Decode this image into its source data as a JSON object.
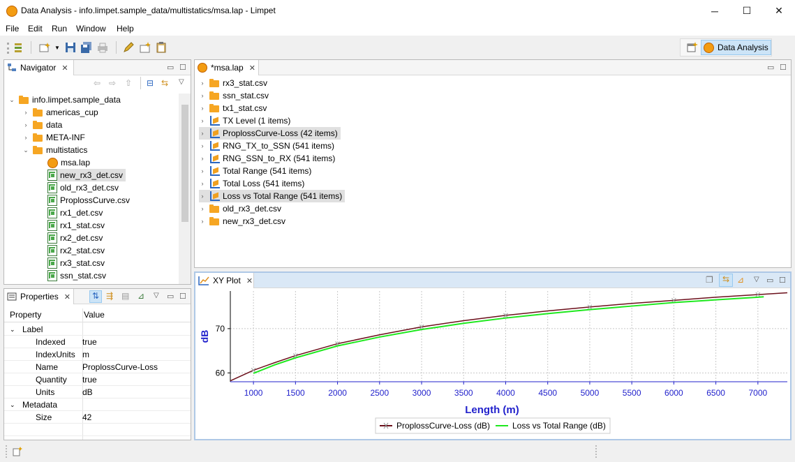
{
  "window": {
    "title": "Data Analysis - info.limpet.sample_data/multistatics/msa.lap - Limpet",
    "minimize": "─",
    "maximize": "☐",
    "close": "✕"
  },
  "menu": [
    "File",
    "Edit",
    "Run",
    "Window",
    "Help"
  ],
  "perspective": {
    "label": "Data Analysis"
  },
  "navigator": {
    "title": "Navigator",
    "root": "info.limpet.sample_data",
    "folders": [
      "americas_cup",
      "data",
      "META-INF",
      "multistatics"
    ],
    "files": [
      "msa.lap",
      "new_rx3_det.csv",
      "old_rx3_det.csv",
      "ProplossCurve.csv",
      "rx1_det.csv",
      "rx1_stat.csv",
      "rx2_det.csv",
      "rx2_stat.csv",
      "rx3_stat.csv",
      "ssn_stat.csv"
    ]
  },
  "properties": {
    "title": "Properties",
    "col_property": "Property",
    "col_value": "Value",
    "label_group": "Label",
    "label_rows": [
      {
        "k": "Indexed",
        "v": "true"
      },
      {
        "k": "IndexUnits",
        "v": "m"
      },
      {
        "k": "Name",
        "v": "ProplossCurve-Loss"
      },
      {
        "k": "Quantity",
        "v": "true"
      },
      {
        "k": "Units",
        "v": "dB"
      }
    ],
    "metadata_group": "Metadata",
    "metadata_rows": [
      {
        "k": "Size",
        "v": "42"
      }
    ]
  },
  "editor": {
    "tab": "*msa.lap",
    "items": [
      {
        "label": "rx3_stat.csv",
        "icon": "folder",
        "sel": false
      },
      {
        "label": "ssn_stat.csv",
        "icon": "folder",
        "sel": false
      },
      {
        "label": "tx1_stat.csv",
        "icon": "folder",
        "sel": false
      },
      {
        "label": "TX Level (1 items)",
        "icon": "dataset",
        "sel": false
      },
      {
        "label": "ProplossCurve-Loss (42 items)",
        "icon": "dataset",
        "sel": true
      },
      {
        "label": "RNG_TX_to_SSN (541 items)",
        "icon": "dataset",
        "sel": false
      },
      {
        "label": "RNG_SSN_to_RX (541 items)",
        "icon": "dataset",
        "sel": false
      },
      {
        "label": "Total Range (541 items)",
        "icon": "dataset",
        "sel": false
      },
      {
        "label": "Total Loss (541 items)",
        "icon": "dataset",
        "sel": false
      },
      {
        "label": "Loss vs Total Range (541 items)",
        "icon": "dataset",
        "sel": true
      },
      {
        "label": "old_rx3_det.csv",
        "icon": "folder",
        "sel": false
      },
      {
        "label": "new_rx3_det.csv",
        "icon": "folder",
        "sel": false
      }
    ]
  },
  "plot_view": {
    "tab": "XY Plot"
  },
  "chart_data": {
    "type": "line",
    "xlabel": "Length (m)",
    "ylabel": "dB",
    "xlim": [
      725,
      7350
    ],
    "ylim": [
      58,
      78.5
    ],
    "xticks": [
      1000,
      1500,
      2000,
      2500,
      3000,
      3500,
      4000,
      4500,
      5000,
      5500,
      6000,
      6500,
      7000
    ],
    "yticks": [
      60,
      70
    ],
    "grid": true,
    "legend_position": "bottom",
    "series": [
      {
        "name": "ProplossCurve-Loss (dB)",
        "color": "#6b0f1a",
        "marker": "x",
        "marker_x": [
          1000,
          1500,
          2000,
          3000,
          4000,
          5000,
          6000,
          7000
        ],
        "x": [
          725,
          1000,
          1250,
          1500,
          2000,
          2500,
          3000,
          3500,
          4000,
          4500,
          5000,
          5500,
          6000,
          6500,
          7000,
          7350
        ],
        "y": [
          58.2,
          60.6,
          62.3,
          63.9,
          66.6,
          68.6,
          70.4,
          71.8,
          73.0,
          74.0,
          74.9,
          75.7,
          76.4,
          77.1,
          77.7,
          78.1
        ]
      },
      {
        "name": "Loss vs Total Range (dB)",
        "color": "#1ee81e",
        "x": [
          1000,
          1250,
          1500,
          2000,
          2500,
          3000,
          3500,
          4000,
          4500,
          5000,
          5500,
          6000,
          6500,
          7000,
          7070
        ],
        "y": [
          59.9,
          61.8,
          63.4,
          66.1,
          68.1,
          69.8,
          71.2,
          72.4,
          73.4,
          74.3,
          75.1,
          75.9,
          76.5,
          77.1,
          77.2
        ]
      }
    ]
  }
}
